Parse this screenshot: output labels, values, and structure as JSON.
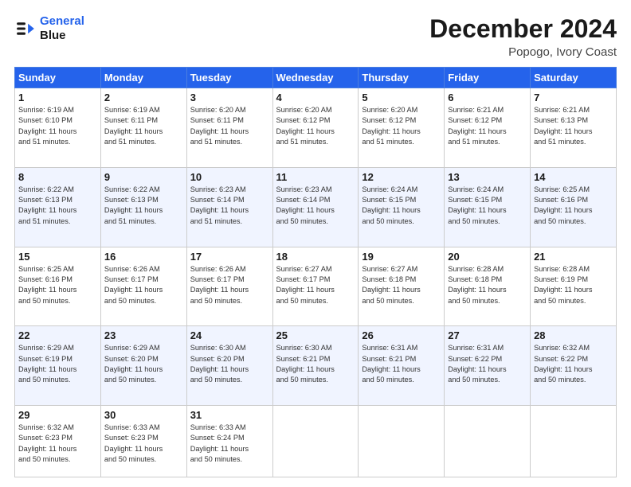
{
  "logo": {
    "line1": "General",
    "line2": "Blue",
    "icon": "▶"
  },
  "title": "December 2024",
  "location": "Popogo, Ivory Coast",
  "days_of_week": [
    "Sunday",
    "Monday",
    "Tuesday",
    "Wednesday",
    "Thursday",
    "Friday",
    "Saturday"
  ],
  "weeks": [
    [
      {
        "day": "1",
        "lines": [
          "Sunrise: 6:19 AM",
          "Sunset: 6:10 PM",
          "Daylight: 11 hours",
          "and 51 minutes."
        ]
      },
      {
        "day": "2",
        "lines": [
          "Sunrise: 6:19 AM",
          "Sunset: 6:11 PM",
          "Daylight: 11 hours",
          "and 51 minutes."
        ]
      },
      {
        "day": "3",
        "lines": [
          "Sunrise: 6:20 AM",
          "Sunset: 6:11 PM",
          "Daylight: 11 hours",
          "and 51 minutes."
        ]
      },
      {
        "day": "4",
        "lines": [
          "Sunrise: 6:20 AM",
          "Sunset: 6:12 PM",
          "Daylight: 11 hours",
          "and 51 minutes."
        ]
      },
      {
        "day": "5",
        "lines": [
          "Sunrise: 6:20 AM",
          "Sunset: 6:12 PM",
          "Daylight: 11 hours",
          "and 51 minutes."
        ]
      },
      {
        "day": "6",
        "lines": [
          "Sunrise: 6:21 AM",
          "Sunset: 6:12 PM",
          "Daylight: 11 hours",
          "and 51 minutes."
        ]
      },
      {
        "day": "7",
        "lines": [
          "Sunrise: 6:21 AM",
          "Sunset: 6:13 PM",
          "Daylight: 11 hours",
          "and 51 minutes."
        ]
      }
    ],
    [
      {
        "day": "8",
        "lines": [
          "Sunrise: 6:22 AM",
          "Sunset: 6:13 PM",
          "Daylight: 11 hours",
          "and 51 minutes."
        ]
      },
      {
        "day": "9",
        "lines": [
          "Sunrise: 6:22 AM",
          "Sunset: 6:13 PM",
          "Daylight: 11 hours",
          "and 51 minutes."
        ]
      },
      {
        "day": "10",
        "lines": [
          "Sunrise: 6:23 AM",
          "Sunset: 6:14 PM",
          "Daylight: 11 hours",
          "and 51 minutes."
        ]
      },
      {
        "day": "11",
        "lines": [
          "Sunrise: 6:23 AM",
          "Sunset: 6:14 PM",
          "Daylight: 11 hours",
          "and 50 minutes."
        ]
      },
      {
        "day": "12",
        "lines": [
          "Sunrise: 6:24 AM",
          "Sunset: 6:15 PM",
          "Daylight: 11 hours",
          "and 50 minutes."
        ]
      },
      {
        "day": "13",
        "lines": [
          "Sunrise: 6:24 AM",
          "Sunset: 6:15 PM",
          "Daylight: 11 hours",
          "and 50 minutes."
        ]
      },
      {
        "day": "14",
        "lines": [
          "Sunrise: 6:25 AM",
          "Sunset: 6:16 PM",
          "Daylight: 11 hours",
          "and 50 minutes."
        ]
      }
    ],
    [
      {
        "day": "15",
        "lines": [
          "Sunrise: 6:25 AM",
          "Sunset: 6:16 PM",
          "Daylight: 11 hours",
          "and 50 minutes."
        ]
      },
      {
        "day": "16",
        "lines": [
          "Sunrise: 6:26 AM",
          "Sunset: 6:17 PM",
          "Daylight: 11 hours",
          "and 50 minutes."
        ]
      },
      {
        "day": "17",
        "lines": [
          "Sunrise: 6:26 AM",
          "Sunset: 6:17 PM",
          "Daylight: 11 hours",
          "and 50 minutes."
        ]
      },
      {
        "day": "18",
        "lines": [
          "Sunrise: 6:27 AM",
          "Sunset: 6:17 PM",
          "Daylight: 11 hours",
          "and 50 minutes."
        ]
      },
      {
        "day": "19",
        "lines": [
          "Sunrise: 6:27 AM",
          "Sunset: 6:18 PM",
          "Daylight: 11 hours",
          "and 50 minutes."
        ]
      },
      {
        "day": "20",
        "lines": [
          "Sunrise: 6:28 AM",
          "Sunset: 6:18 PM",
          "Daylight: 11 hours",
          "and 50 minutes."
        ]
      },
      {
        "day": "21",
        "lines": [
          "Sunrise: 6:28 AM",
          "Sunset: 6:19 PM",
          "Daylight: 11 hours",
          "and 50 minutes."
        ]
      }
    ],
    [
      {
        "day": "22",
        "lines": [
          "Sunrise: 6:29 AM",
          "Sunset: 6:19 PM",
          "Daylight: 11 hours",
          "and 50 minutes."
        ]
      },
      {
        "day": "23",
        "lines": [
          "Sunrise: 6:29 AM",
          "Sunset: 6:20 PM",
          "Daylight: 11 hours",
          "and 50 minutes."
        ]
      },
      {
        "day": "24",
        "lines": [
          "Sunrise: 6:30 AM",
          "Sunset: 6:20 PM",
          "Daylight: 11 hours",
          "and 50 minutes."
        ]
      },
      {
        "day": "25",
        "lines": [
          "Sunrise: 6:30 AM",
          "Sunset: 6:21 PM",
          "Daylight: 11 hours",
          "and 50 minutes."
        ]
      },
      {
        "day": "26",
        "lines": [
          "Sunrise: 6:31 AM",
          "Sunset: 6:21 PM",
          "Daylight: 11 hours",
          "and 50 minutes."
        ]
      },
      {
        "day": "27",
        "lines": [
          "Sunrise: 6:31 AM",
          "Sunset: 6:22 PM",
          "Daylight: 11 hours",
          "and 50 minutes."
        ]
      },
      {
        "day": "28",
        "lines": [
          "Sunrise: 6:32 AM",
          "Sunset: 6:22 PM",
          "Daylight: 11 hours",
          "and 50 minutes."
        ]
      }
    ],
    [
      {
        "day": "29",
        "lines": [
          "Sunrise: 6:32 AM",
          "Sunset: 6:23 PM",
          "Daylight: 11 hours",
          "and 50 minutes."
        ]
      },
      {
        "day": "30",
        "lines": [
          "Sunrise: 6:33 AM",
          "Sunset: 6:23 PM",
          "Daylight: 11 hours",
          "and 50 minutes."
        ]
      },
      {
        "day": "31",
        "lines": [
          "Sunrise: 6:33 AM",
          "Sunset: 6:24 PM",
          "Daylight: 11 hours",
          "and 50 minutes."
        ]
      },
      null,
      null,
      null,
      null
    ]
  ]
}
